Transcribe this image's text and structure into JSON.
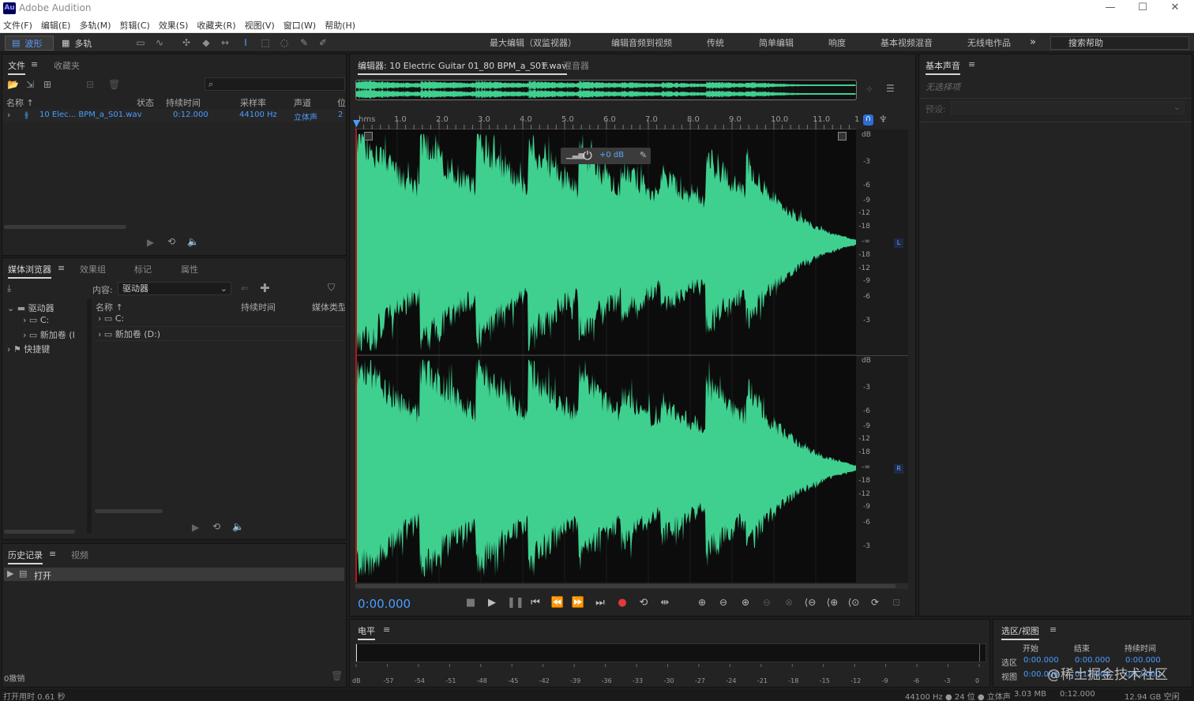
{
  "app": {
    "logo": "Au",
    "title": "Adobe Audition"
  },
  "window_controls": [
    "—",
    "☐",
    "✕"
  ],
  "menu": [
    "文件(F)",
    "编辑(E)",
    "多轨(M)",
    "剪辑(C)",
    "效果(S)",
    "收藏夹(R)",
    "视图(V)",
    "窗口(W)",
    "帮助(H)"
  ],
  "toolbar": {
    "mode_wave": "波形",
    "mode_multitrack": "多轨"
  },
  "workspaces": [
    "最大编辑（双监视器）",
    "编辑音频到视频",
    "传统",
    "简单编辑",
    "响度",
    "基本视频混音",
    "无线电作品"
  ],
  "workspace_more": "»",
  "help_search": {
    "placeholder": "搜索帮助"
  },
  "files_panel": {
    "tabs": [
      "文件",
      "收藏夹"
    ],
    "columns": [
      "名称 ↑",
      "状态",
      "持续时间",
      "采样率",
      "声道",
      "位"
    ],
    "row": {
      "name": "10 Elec... BPM_a_S01.wav",
      "duration": "0:12.000",
      "rate": "44100 Hz",
      "channels": "立体声",
      "bit": "2"
    }
  },
  "media_panel": {
    "tabs": [
      "媒体浏览器",
      "效果组",
      "标记",
      "属性"
    ],
    "content_label": "内容:",
    "content_value": "驱动器",
    "tree": [
      "驱动器",
      "C:",
      "新加卷 (I",
      "快捷键"
    ],
    "columns": [
      "名称 ↑",
      "持续时间",
      "媒体类型"
    ],
    "list": [
      "C:",
      "新加卷 (D:)"
    ]
  },
  "history_panel": {
    "tabs": [
      "历史记录",
      "视频"
    ],
    "item": "打开",
    "undo_count": "0撤销",
    "open_time": "打开用时 0.61 秒"
  },
  "editor": {
    "tab_title": "编辑器: 10 Electric Guitar 01_80 BPM_a_S01.wav",
    "tab_mixer": "混音器",
    "ruler_unit": "hms",
    "ruler_ticks": [
      "1.0",
      "2.0",
      "3.0",
      "4.0",
      "5.0",
      "6.0",
      "7.0",
      "8.0",
      "9.0",
      "10.0",
      "11.0",
      "1"
    ],
    "hud_gain": "+0 dB",
    "db_unit": "dB",
    "db_scale_top": [
      "-3",
      "-6",
      "-9",
      "-12",
      "-18",
      "-∞",
      "-18",
      "-12",
      "-9",
      "-6",
      "-3"
    ],
    "db_scale_bottom": [
      "-3",
      "-6",
      "-9",
      "-12",
      "-18",
      "-∞",
      "-18",
      "-12",
      "-9",
      "-6",
      "-3"
    ],
    "channel_left": "L",
    "channel_right": "R",
    "current_time": "0:00.000",
    "waveform_color": "#3fd08f"
  },
  "levels_panel": {
    "title": "电平",
    "scale": [
      "dB",
      "-57",
      "-54",
      "-51",
      "-48",
      "-45",
      "-42",
      "-39",
      "-36",
      "-33",
      "-30",
      "-27",
      "-24",
      "-21",
      "-18",
      "-15",
      "-12",
      "-9",
      "-6",
      "-3",
      "0"
    ]
  },
  "essential_sound": {
    "title": "基本声音",
    "no_selection": "无选择项",
    "preset_label": "预设:"
  },
  "selection_view": {
    "title": "选区/视图",
    "headers": [
      "开始",
      "结束",
      "持续时间"
    ],
    "selection_label": "选区",
    "view_label": "视图",
    "selection": [
      "0:00.000",
      "0:00.000",
      "0:00.000"
    ],
    "view": [
      "0:00.000",
      "0:12.000",
      "0:12.000"
    ]
  },
  "watermark": "@稀土掘金技术社区",
  "status": {
    "format": "44100 Hz ● 24 位 ● 立体声",
    "file_size": "3.03 MB",
    "duration": "0:12.000",
    "free_space": "12.94 GB 空闲"
  }
}
